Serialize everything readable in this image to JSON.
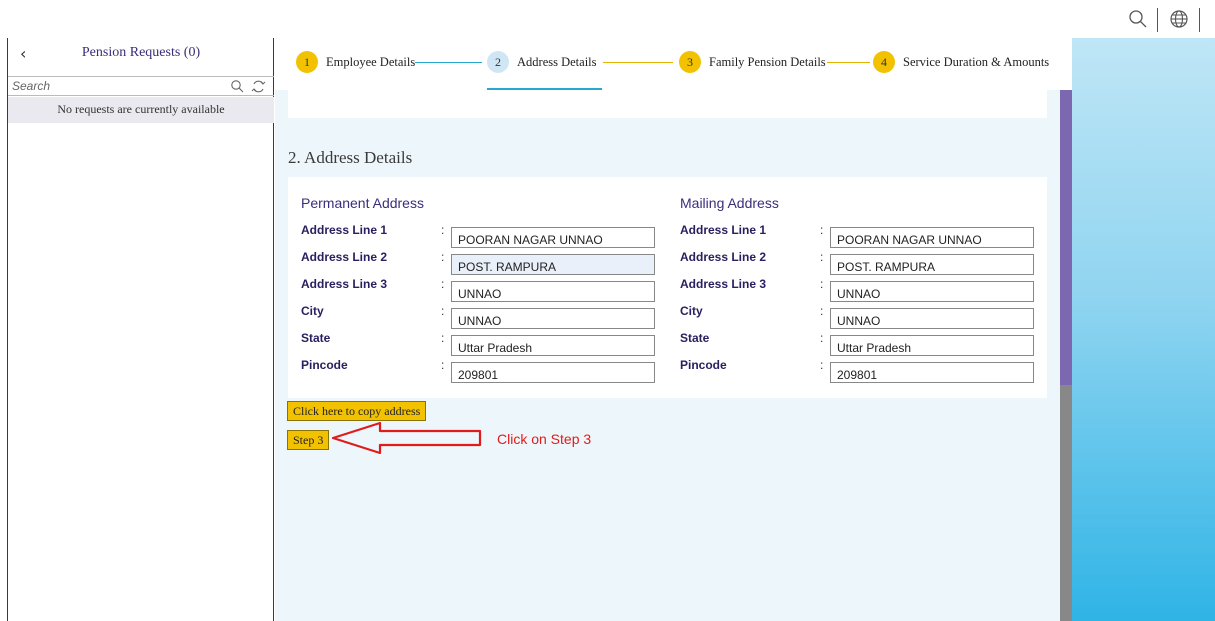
{
  "sidebar": {
    "title": "Pension Requests (0)",
    "search_placeholder": "Search",
    "empty_message": "No requests are currently available"
  },
  "steps": [
    {
      "number": "1",
      "label": "Employee Details",
      "state": "done"
    },
    {
      "number": "2",
      "label": "Address Details",
      "state": "active"
    },
    {
      "number": "3",
      "label": "Family Pension Details",
      "state": "pending"
    },
    {
      "number": "4",
      "label": "Service Duration & Amounts",
      "state": "pending"
    }
  ],
  "section_title": "2. Address Details",
  "permanent": {
    "title": "Permanent Address",
    "fields": [
      {
        "label": "Address Line 1",
        "value": "POORAN NAGAR UNNAO"
      },
      {
        "label": "Address Line 2",
        "value": "POST. RAMPURA"
      },
      {
        "label": "Address Line 3",
        "value": "UNNAO"
      },
      {
        "label": "City",
        "value": "UNNAO"
      },
      {
        "label": "State",
        "value": "Uttar Pradesh"
      },
      {
        "label": "Pincode",
        "value": "209801"
      }
    ]
  },
  "mailing": {
    "title": "Mailing Address",
    "fields": [
      {
        "label": "Address Line 1",
        "value": "POORAN NAGAR UNNAO"
      },
      {
        "label": "Address Line 2",
        "value": "POST. RAMPURA"
      },
      {
        "label": "Address Line 3",
        "value": "UNNAO"
      },
      {
        "label": "City",
        "value": "UNNAO"
      },
      {
        "label": "State",
        "value": "Uttar Pradesh"
      },
      {
        "label": "Pincode",
        "value": "209801"
      }
    ]
  },
  "colon": ":",
  "buttons": {
    "copy_address": "Click here to copy address",
    "step3": "Step 3"
  },
  "annotation": "Click on Step 3",
  "colors": {
    "accent_yellow": "#f2c200",
    "active_blue": "#28a7cf",
    "brand_purple": "#3b2d7a",
    "annotation_red": "#e01b1b"
  }
}
